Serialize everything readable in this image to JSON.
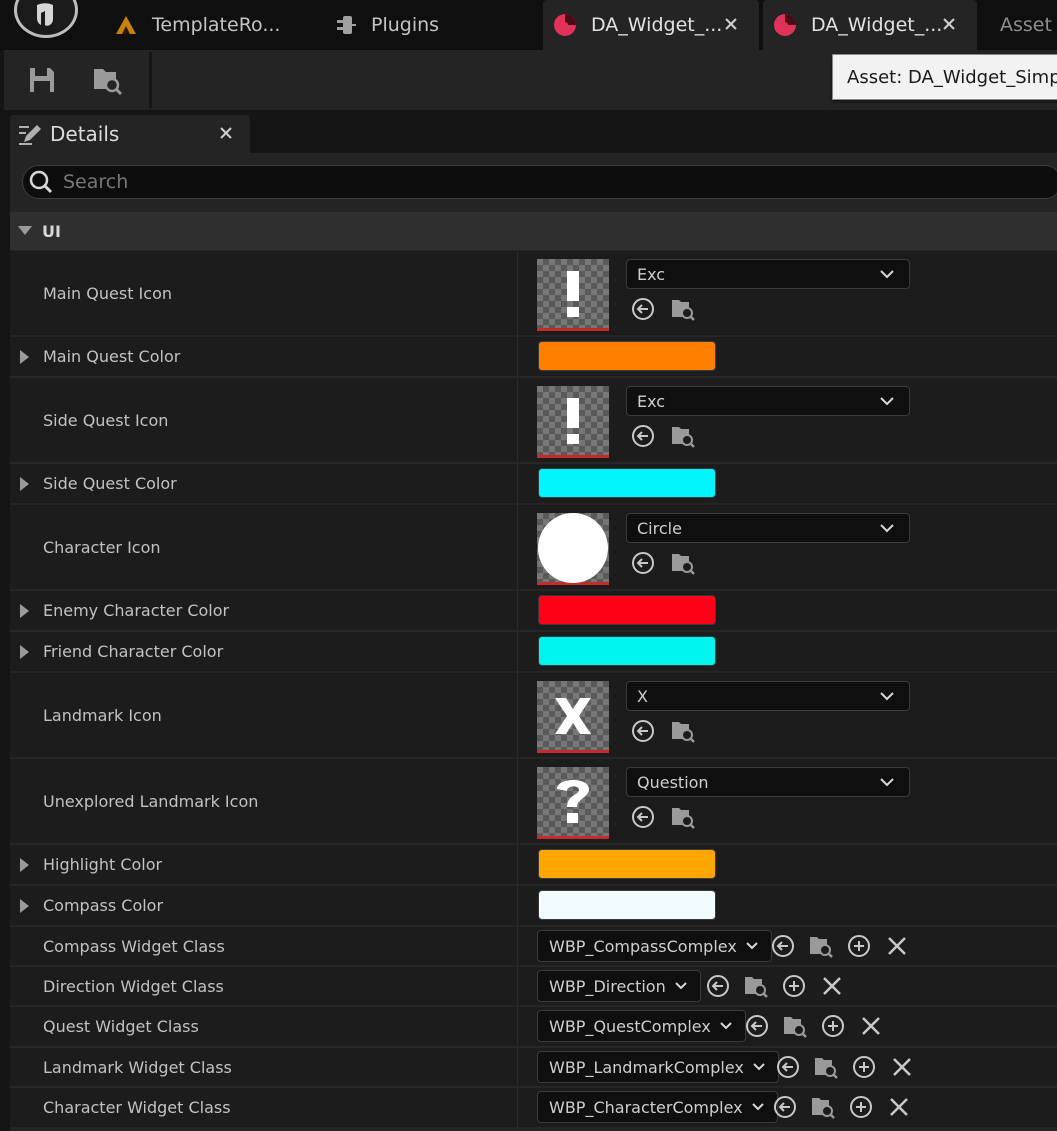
{
  "tabs": [
    {
      "label": "TemplateRo...",
      "icon": "project-icon"
    },
    {
      "label": "Plugins",
      "icon": "plugin-icon"
    },
    {
      "label": "DA_Widget_...",
      "icon": "data-asset-icon"
    },
    {
      "label": "DA_Widget_...",
      "icon": "data-asset-icon"
    },
    {
      "label": "Asset"
    }
  ],
  "tooltip": "Asset: DA_Widget_Simple",
  "details": {
    "title": "Details",
    "search_placeholder": "Search",
    "category": "UI",
    "rows": {
      "main_quest_icon": {
        "label": "Main Quest Icon",
        "value": "Exc"
      },
      "main_quest_color": {
        "label": "Main Quest Color",
        "color": "#ff8000"
      },
      "side_quest_icon": {
        "label": "Side Quest Icon",
        "value": "Exc"
      },
      "side_quest_color": {
        "label": "Side Quest Color",
        "color": "#00f5ff"
      },
      "character_icon": {
        "label": "Character Icon",
        "value": "Circle"
      },
      "enemy_character_color": {
        "label": "Enemy Character Color",
        "color": "#ff0019"
      },
      "friend_character_color": {
        "label": "Friend Character Color",
        "color": "#00f5f0"
      },
      "landmark_icon": {
        "label": "Landmark Icon",
        "value": "X"
      },
      "unexplored_landmark_icon": {
        "label": "Unexplored Landmark Icon",
        "value": "Question"
      },
      "highlight_color": {
        "label": "Highlight Color",
        "color": "#ffa600"
      },
      "compass_color": {
        "label": "Compass Color",
        "color": "#f2fbff"
      },
      "compass_widget_class": {
        "label": "Compass Widget Class",
        "value": "WBP_CompassComplex"
      },
      "direction_widget_class": {
        "label": "Direction Widget Class",
        "value": "WBP_Direction"
      },
      "quest_widget_class": {
        "label": "Quest Widget Class",
        "value": "WBP_QuestComplex"
      },
      "landmark_widget_class": {
        "label": "Landmark Widget Class",
        "value": "WBP_LandmarkComplex"
      },
      "character_widget_class": {
        "label": "Character Widget Class",
        "value": "WBP_CharacterComplex"
      }
    }
  }
}
